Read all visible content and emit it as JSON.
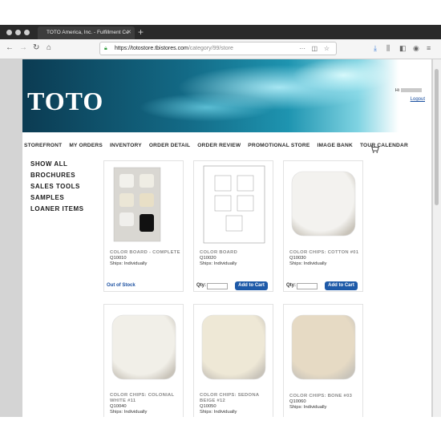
{
  "browser": {
    "tab_title": "TOTO America, Inc. - Fulfillment Ce",
    "tab_close": "✕",
    "new_tab": "+",
    "url_host": "https://totostore.tbistores.com",
    "url_path": "/category/99/store",
    "url_icons": [
      "···",
      "◫",
      "☆"
    ],
    "toolbar_icons": [
      "download-icon",
      "library-icon",
      "sidebar-icon",
      "account-icon",
      "menu-icon"
    ]
  },
  "site": {
    "logo": "TOTO",
    "greeting": "Hi",
    "logout": "Logout"
  },
  "nav": [
    "STOREFRONT",
    "MY ORDERS",
    "INVENTORY",
    "ORDER DETAIL",
    "ORDER REVIEW",
    "PROMOTIONAL STORE",
    "IMAGE BANK",
    "TOUR CALENDAR"
  ],
  "sidebar": [
    "SHOW ALL",
    "BROCHURES",
    "SALES TOOLS",
    "SAMPLES",
    "LOANER ITEMS"
  ],
  "products": [
    {
      "name": "COLOR BOARD - COMPLETE",
      "sku": "Q10010",
      "ships": "Ships: Individually",
      "status": "Out of Stock",
      "image": "color-board-complete",
      "swatch": "#efefef"
    },
    {
      "name": "COLOR BOARD",
      "sku": "Q10020",
      "ships": "Ships: Individually",
      "status": "",
      "image": "color-board",
      "swatch": "#f4f4f4"
    },
    {
      "name": "COLOR CHIPS: COTTON #01",
      "sku": "Q10030",
      "ships": "Ships: Individually",
      "status": "",
      "image": "chip",
      "swatch": "#f3f2ef"
    },
    {
      "name": "COLOR CHIPS: COLONIAL WHITE #11",
      "sku": "Q10040",
      "ships": "Ships: Individually",
      "status": "",
      "image": "chip",
      "swatch": "#f1efe8"
    },
    {
      "name": "COLOR CHIPS: SEDONA BEIGE #12",
      "sku": "Q10050",
      "ships": "Ships: Individually",
      "status": "",
      "image": "chip",
      "swatch": "#eee8d6"
    },
    {
      "name": "COLOR CHIPS: BONE #03",
      "sku": "Q10060",
      "ships": "Ships: Individually",
      "status": "",
      "image": "chip",
      "swatch": "#e6dac4"
    }
  ],
  "cart_labels": {
    "qty": "Qty:",
    "add": "Add to Cart"
  }
}
